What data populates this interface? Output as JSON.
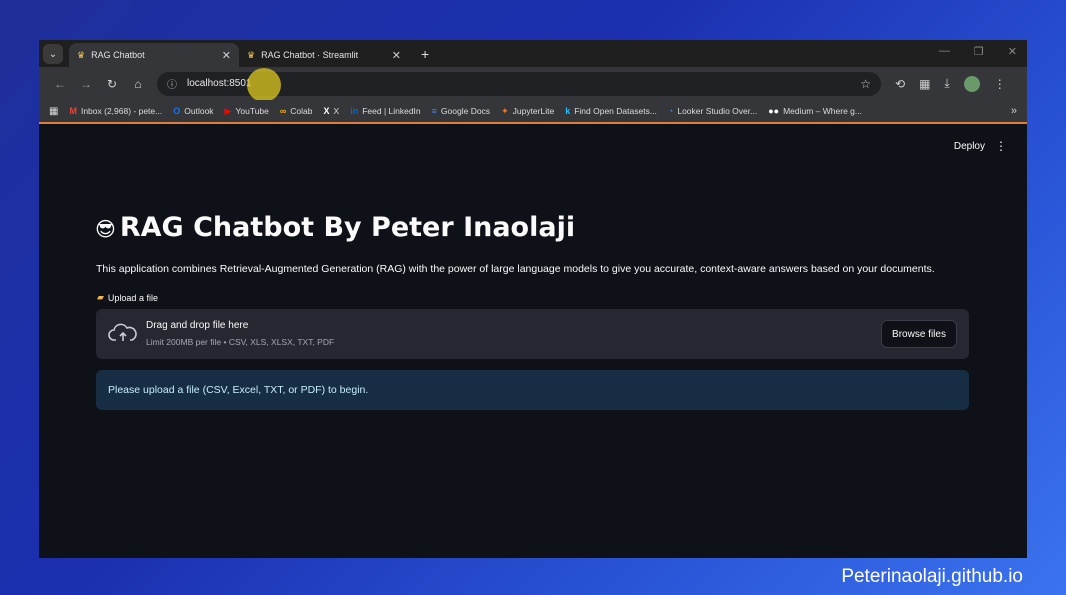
{
  "browser": {
    "tabs": [
      {
        "title": "RAG Chatbot",
        "active": true
      },
      {
        "title": "RAG Chatbot · Streamlit",
        "active": false
      }
    ],
    "url": "localhost:8501",
    "bookmarks": [
      {
        "label": "Inbox (2,968) - pete...",
        "icon": "gmail-icon",
        "glyph": "M",
        "color": "#ea4335"
      },
      {
        "label": "Outlook",
        "icon": "outlook-icon",
        "glyph": "O",
        "color": "#1a73e8"
      },
      {
        "label": "YouTube",
        "icon": "youtube-icon",
        "glyph": "▶",
        "color": "#ff0000"
      },
      {
        "label": "Colab",
        "icon": "colab-icon",
        "glyph": "∞",
        "color": "#f9ab00"
      },
      {
        "label": "X",
        "icon": "x-icon",
        "glyph": "X",
        "color": "#ffffff"
      },
      {
        "label": "Feed | LinkedIn",
        "icon": "linkedin-icon",
        "glyph": "in",
        "color": "#0a66c2"
      },
      {
        "label": "Google Docs",
        "icon": "google-docs-icon",
        "glyph": "≡",
        "color": "#4285f4"
      },
      {
        "label": "JupyterLite",
        "icon": "jupyter-icon",
        "glyph": "✦",
        "color": "#f37626"
      },
      {
        "label": "Find Open Datasets...",
        "icon": "kaggle-icon",
        "glyph": "k",
        "color": "#20beff"
      },
      {
        "label": "Looker Studio Over...",
        "icon": "looker-icon",
        "glyph": "◔",
        "color": "#4285f4"
      },
      {
        "label": "Medium – Where g...",
        "icon": "medium-icon",
        "glyph": "●●",
        "color": "#ffffff"
      }
    ]
  },
  "app": {
    "deploy_label": "Deploy",
    "title_emoji": "😎",
    "title": "RAG Chatbot By Peter Inaolaji",
    "description": "This application combines Retrieval-Augmented Generation (RAG) with the power of large language models to give you accurate, context-aware answers based on your documents.",
    "upload_label": "Upload a file",
    "dropzone_main": "Drag and drop file here",
    "dropzone_sub": "Limit 200MB per file • CSV, XLS, XLSX, TXT, PDF",
    "browse_label": "Browse files",
    "info_message": "Please upload a file (CSV, Excel, TXT, or PDF) to begin."
  },
  "watermark": "Peterinaolaji.github.io"
}
